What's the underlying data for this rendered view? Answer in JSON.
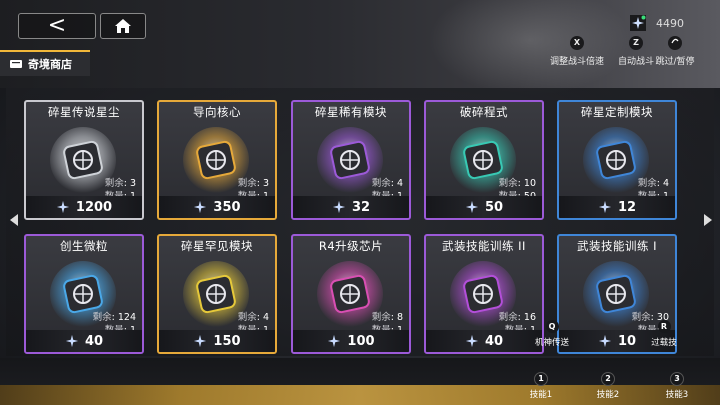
{
  "header": {
    "back_glyph": "<",
    "currency_amount": "4490",
    "hotkeys": [
      {
        "key": "X",
        "label": "调整战斗倍速"
      },
      {
        "key": "Z",
        "label": "自动战斗"
      },
      {
        "key": "",
        "label": "跳过/暂停"
      }
    ]
  },
  "shop": {
    "tab_label": "奇境商店",
    "items": [
      {
        "name": "碎星传说星尘",
        "remaining_label": "剩余",
        "remaining": "3",
        "qty_label": "数量",
        "qty": "1",
        "price": "1200",
        "rarity": "white",
        "color": "#cfd3d8"
      },
      {
        "name": "导向核心",
        "remaining_label": "剩余",
        "remaining": "3",
        "qty_label": "数量",
        "qty": "1",
        "price": "350",
        "rarity": "gold",
        "color": "#e6a93a"
      },
      {
        "name": "碎星稀有模块",
        "remaining_label": "剩余",
        "remaining": "4",
        "qty_label": "数量",
        "qty": "1",
        "price": "32",
        "rarity": "purple",
        "color": "#9c5ad8"
      },
      {
        "name": "破碎程式",
        "remaining_label": "剩余",
        "remaining": "10",
        "qty_label": "数量",
        "qty": "50",
        "price": "50",
        "rarity": "purple",
        "color": "#38c9b4"
      },
      {
        "name": "碎星定制模块",
        "remaining_label": "剩余",
        "remaining": "4",
        "qty_label": "数量",
        "qty": "1",
        "price": "12",
        "rarity": "blue",
        "color": "#3f86d8"
      },
      {
        "name": "创生微粒",
        "remaining_label": "剩余",
        "remaining": "124",
        "qty_label": "数量",
        "qty": "1",
        "price": "40",
        "rarity": "purple",
        "color": "#4aa8e8"
      },
      {
        "name": "碎星罕见模块",
        "remaining_label": "剩余",
        "remaining": "4",
        "qty_label": "数量",
        "qty": "1",
        "price": "150",
        "rarity": "gold",
        "color": "#e6c93a"
      },
      {
        "name": "R4升级芯片",
        "remaining_label": "剩余",
        "remaining": "8",
        "qty_label": "数量",
        "qty": "1",
        "price": "100",
        "rarity": "purple",
        "color": "#d94fb3"
      },
      {
        "name": "武装技能训练 II",
        "remaining_label": "剩余",
        "remaining": "16",
        "qty_label": "数量",
        "qty": "1",
        "price": "40",
        "rarity": "purple",
        "color": "#b34fd9"
      },
      {
        "name": "武装技能训练 I",
        "remaining_label": "剩余",
        "remaining": "30",
        "qty_label": "数量",
        "qty": "1",
        "price": "10",
        "rarity": "blue",
        "color": "#3f86d8"
      }
    ]
  },
  "float_keys": [
    {
      "key": "Q",
      "label": "机神传送"
    },
    {
      "key": "R",
      "label": "过载技"
    }
  ],
  "skills": [
    {
      "key": "1",
      "label": "技能1"
    },
    {
      "key": "2",
      "label": "技能2"
    },
    {
      "key": "3",
      "label": "技能3"
    }
  ]
}
